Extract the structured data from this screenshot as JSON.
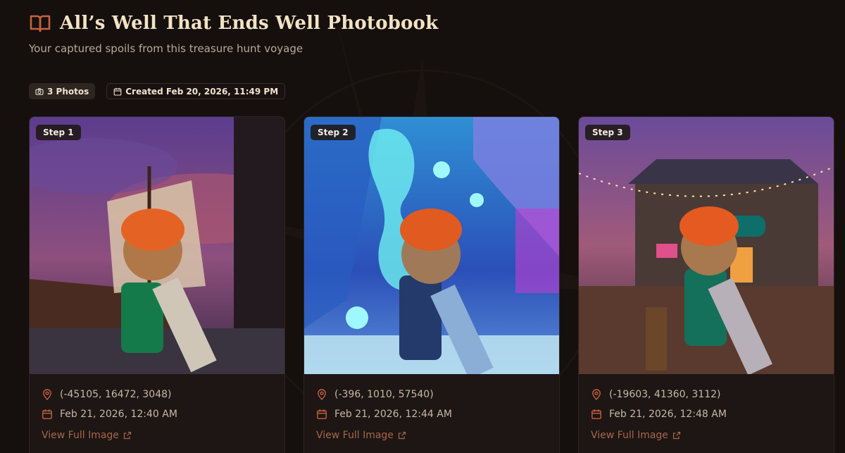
{
  "header": {
    "title": "All’s Well That Ends Well Photobook",
    "subtitle": "Your captured spoils from this treasure hunt voyage",
    "icon": "open-book-icon"
  },
  "meta": {
    "photos_label": "3 Photos",
    "created_label": "Created Feb 20, 2026, 11:49 PM"
  },
  "cards": [
    {
      "step": "Step 1",
      "coords": "(-45105, 16472, 3048)",
      "date": "Feb 21, 2026, 12:40 AM",
      "link": "View Full Image",
      "scene": "pirate-ship-sunset"
    },
    {
      "step": "Step 2",
      "coords": "(-396, 1010, 57540)",
      "date": "Feb 21, 2026, 12:44 AM",
      "link": "View Full Image",
      "scene": "glowing-underwater-coral"
    },
    {
      "step": "Step 3",
      "coords": "(-19603, 41360, 3112)",
      "date": "Feb 21, 2026, 12:48 AM",
      "link": "View Full Image",
      "scene": "bayc-clubhouse-night"
    }
  ],
  "colors": {
    "background": "#150f0d",
    "card": "#1d1614",
    "accent": "#c4623e",
    "link": "#a8664a"
  }
}
